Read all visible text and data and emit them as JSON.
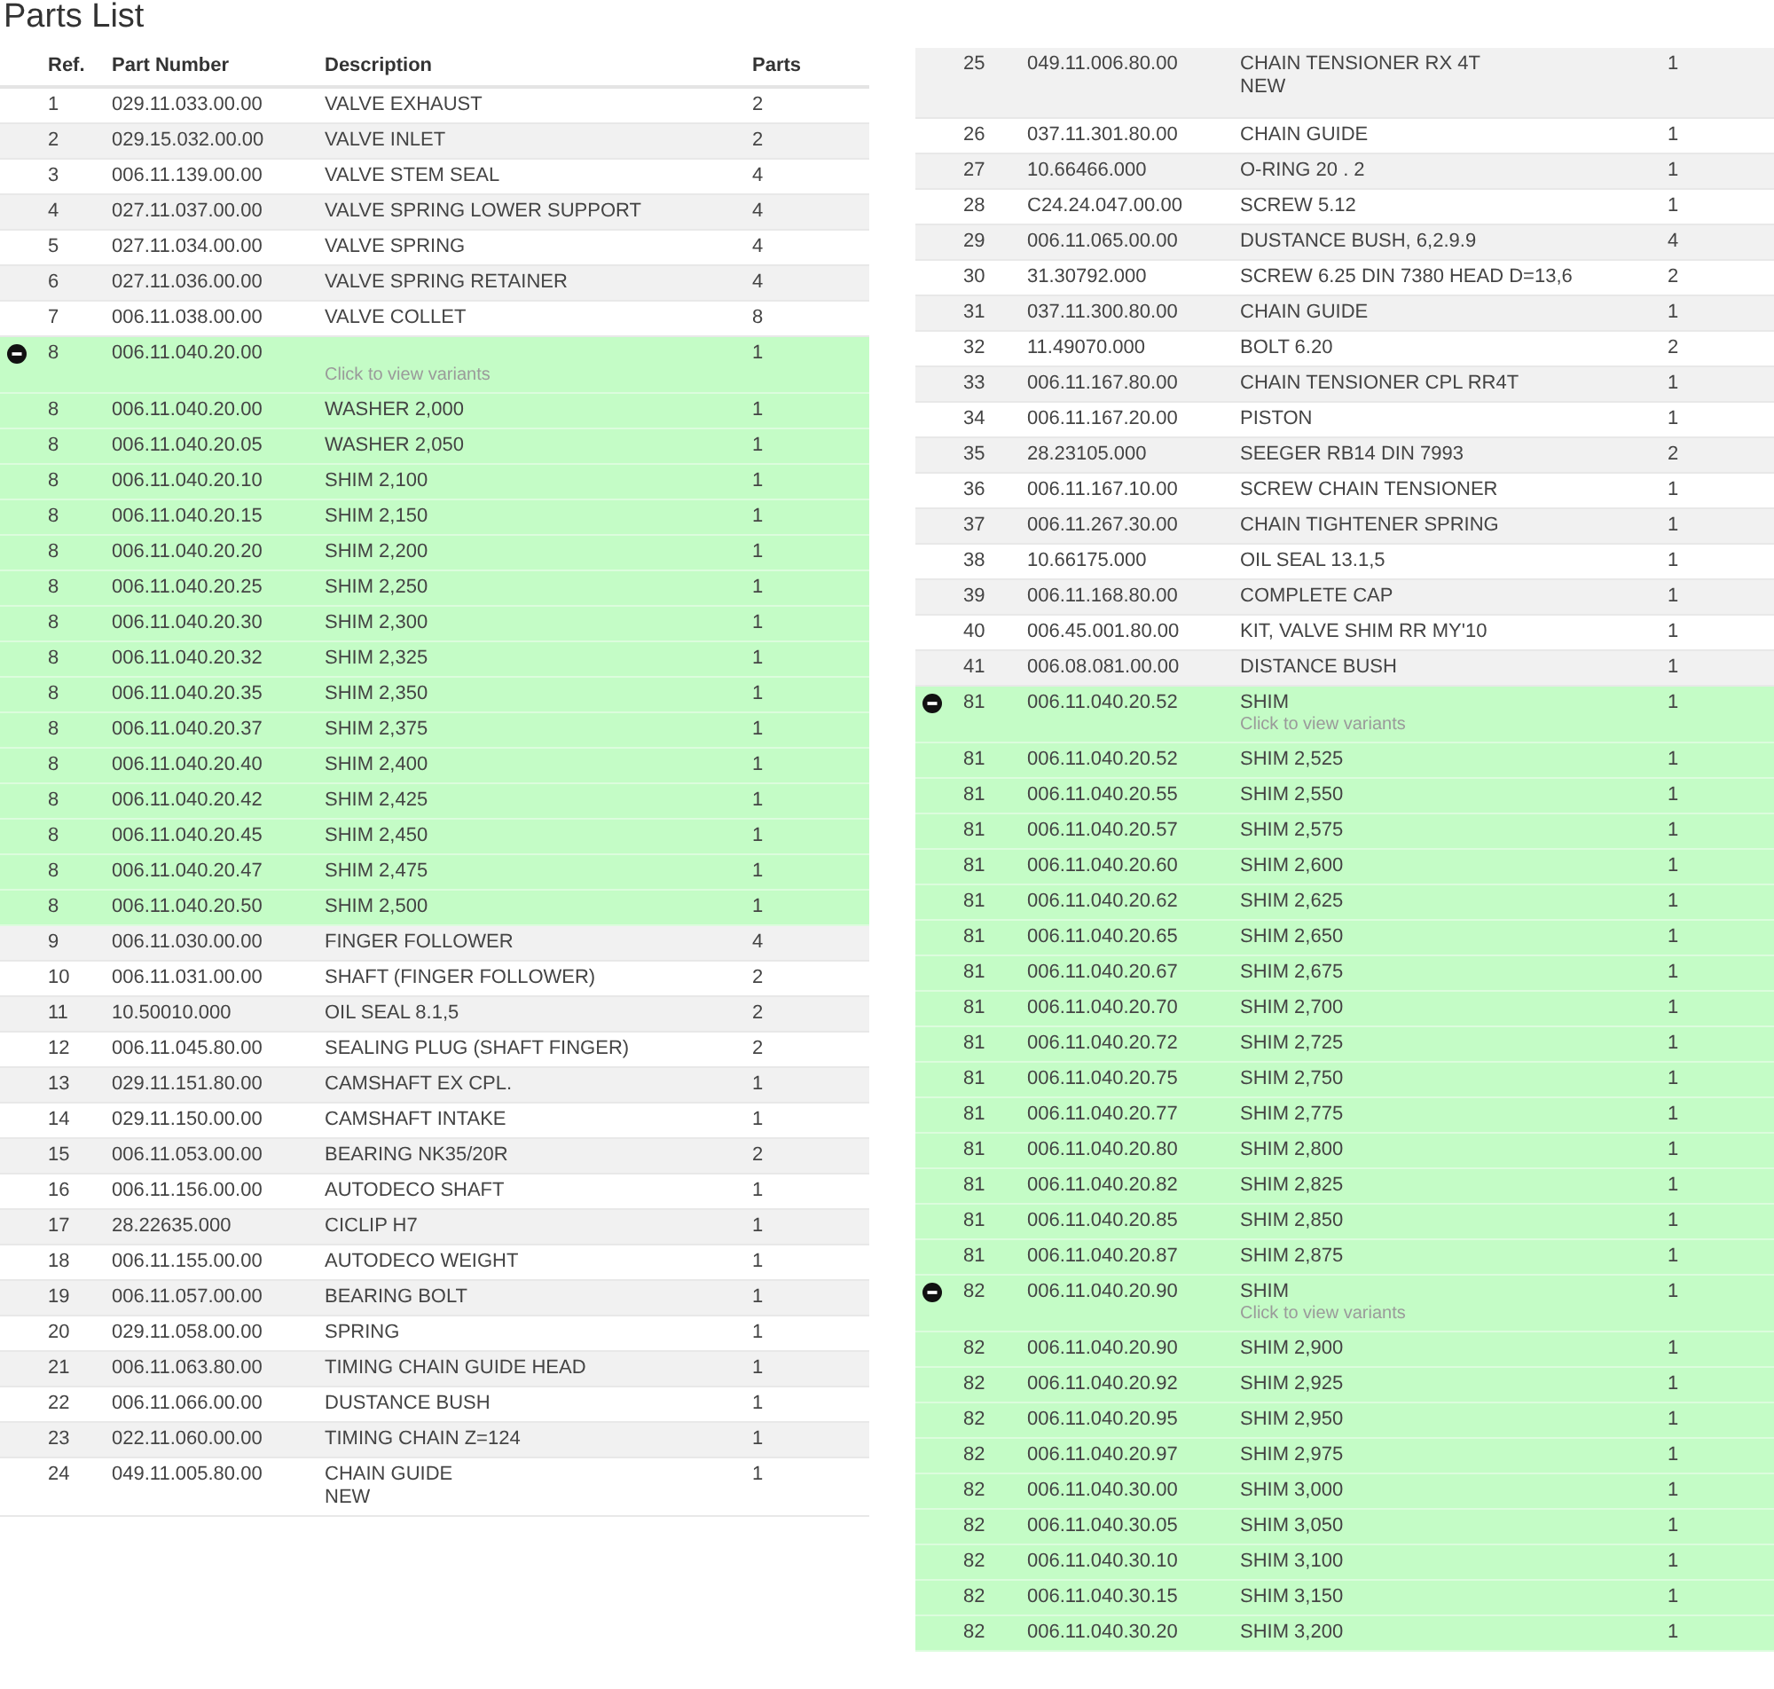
{
  "title": "Parts List",
  "columns": [
    "Ref.",
    "Part Number",
    "Description",
    "Parts"
  ],
  "left_rows": [
    {
      "kind": "part",
      "ref": "1",
      "part_number": "029.11.033.00.00",
      "description": "VALVE EXHAUST",
      "parts": "2"
    },
    {
      "kind": "part",
      "ref": "2",
      "part_number": "029.15.032.00.00",
      "description": "VALVE INLET",
      "parts": "2"
    },
    {
      "kind": "part",
      "ref": "3",
      "part_number": "006.11.139.00.00",
      "description": "VALVE STEM SEAL",
      "parts": "4"
    },
    {
      "kind": "part",
      "ref": "4",
      "part_number": "027.11.037.00.00",
      "description": "VALVE SPRING LOWER SUPPORT",
      "parts": "4"
    },
    {
      "kind": "part",
      "ref": "5",
      "part_number": "027.11.034.00.00",
      "description": "VALVE SPRING",
      "parts": "4"
    },
    {
      "kind": "part",
      "ref": "6",
      "part_number": "027.11.036.00.00",
      "description": "VALVE SPRING RETAINER",
      "parts": "4"
    },
    {
      "kind": "part",
      "ref": "7",
      "part_number": "006.11.038.00.00",
      "description": "VALVE COLLET",
      "parts": "8"
    },
    {
      "kind": "group",
      "expanded": true,
      "ref": "8",
      "part_number": "006.11.040.20.00",
      "hint": "Click to view variants",
      "parts": "1"
    },
    {
      "kind": "variant",
      "ref": "8",
      "part_number": "006.11.040.20.00",
      "description": "WASHER 2,000",
      "parts": "1"
    },
    {
      "kind": "variant",
      "ref": "8",
      "part_number": "006.11.040.20.05",
      "description": "WASHER 2,050",
      "parts": "1"
    },
    {
      "kind": "variant",
      "ref": "8",
      "part_number": "006.11.040.20.10",
      "description": "SHIM 2,100",
      "parts": "1"
    },
    {
      "kind": "variant",
      "ref": "8",
      "part_number": "006.11.040.20.15",
      "description": "SHIM 2,150",
      "parts": "1"
    },
    {
      "kind": "variant",
      "ref": "8",
      "part_number": "006.11.040.20.20",
      "description": "SHIM 2,200",
      "parts": "1"
    },
    {
      "kind": "variant",
      "ref": "8",
      "part_number": "006.11.040.20.25",
      "description": "SHIM 2,250",
      "parts": "1"
    },
    {
      "kind": "variant",
      "ref": "8",
      "part_number": "006.11.040.20.30",
      "description": "SHIM 2,300",
      "parts": "1"
    },
    {
      "kind": "variant",
      "ref": "8",
      "part_number": "006.11.040.20.32",
      "description": "SHIM 2,325",
      "parts": "1"
    },
    {
      "kind": "variant",
      "ref": "8",
      "part_number": "006.11.040.20.35",
      "description": "SHIM 2,350",
      "parts": "1"
    },
    {
      "kind": "variant",
      "ref": "8",
      "part_number": "006.11.040.20.37",
      "description": "SHIM 2,375",
      "parts": "1"
    },
    {
      "kind": "variant",
      "ref": "8",
      "part_number": "006.11.040.20.40",
      "description": "SHIM 2,400",
      "parts": "1"
    },
    {
      "kind": "variant",
      "ref": "8",
      "part_number": "006.11.040.20.42",
      "description": "SHIM 2,425",
      "parts": "1"
    },
    {
      "kind": "variant",
      "ref": "8",
      "part_number": "006.11.040.20.45",
      "description": "SHIM 2,450",
      "parts": "1"
    },
    {
      "kind": "variant",
      "ref": "8",
      "part_number": "006.11.040.20.47",
      "description": "SHIM 2,475",
      "parts": "1"
    },
    {
      "kind": "variant",
      "ref": "8",
      "part_number": "006.11.040.20.50",
      "description": "SHIM 2,500",
      "parts": "1"
    },
    {
      "kind": "part",
      "ref": "9",
      "part_number": "006.11.030.00.00",
      "description": "FINGER FOLLOWER",
      "parts": "4"
    },
    {
      "kind": "part",
      "ref": "10",
      "part_number": "006.11.031.00.00",
      "description": "SHAFT (FINGER FOLLOWER)",
      "parts": "2"
    },
    {
      "kind": "part",
      "ref": "11",
      "part_number": "10.50010.000",
      "description": "OIL SEAL 8.1,5",
      "parts": "2"
    },
    {
      "kind": "part",
      "ref": "12",
      "part_number": "006.11.045.80.00",
      "description": "SEALING PLUG (SHAFT FINGER)",
      "parts": "2"
    },
    {
      "kind": "part",
      "ref": "13",
      "part_number": "029.11.151.80.00",
      "description": "CAMSHAFT EX CPL.",
      "parts": "1"
    },
    {
      "kind": "part",
      "ref": "14",
      "part_number": "029.11.150.00.00",
      "description": "CAMSHAFT INTAKE",
      "parts": "1"
    },
    {
      "kind": "part",
      "ref": "15",
      "part_number": "006.11.053.00.00",
      "description": "BEARING NK35/20R",
      "parts": "2"
    },
    {
      "kind": "part",
      "ref": "16",
      "part_number": "006.11.156.00.00",
      "description": "AUTODECO SHAFT",
      "parts": "1"
    },
    {
      "kind": "part",
      "ref": "17",
      "part_number": "28.22635.000",
      "description": "CICLIP H7",
      "parts": "1"
    },
    {
      "kind": "part",
      "ref": "18",
      "part_number": "006.11.155.00.00",
      "description": "AUTODECO WEIGHT",
      "parts": "1"
    },
    {
      "kind": "part",
      "ref": "19",
      "part_number": "006.11.057.00.00",
      "description": "BEARING BOLT",
      "parts": "1"
    },
    {
      "kind": "part",
      "ref": "20",
      "part_number": "029.11.058.00.00",
      "description": "SPRING",
      "parts": "1"
    },
    {
      "kind": "part",
      "ref": "21",
      "part_number": "006.11.063.80.00",
      "description": "TIMING CHAIN GUIDE HEAD",
      "parts": "1"
    },
    {
      "kind": "part",
      "ref": "22",
      "part_number": "006.11.066.00.00",
      "description": "DUSTANCE BUSH",
      "parts": "1"
    },
    {
      "kind": "part",
      "ref": "23",
      "part_number": "022.11.060.00.00",
      "description": "TIMING CHAIN Z=124",
      "parts": "1"
    },
    {
      "kind": "part",
      "ref": "24",
      "part_number": "049.11.005.80.00",
      "description": "CHAIN GUIDE\nNEW",
      "parts": "1"
    }
  ],
  "right_rows": [
    {
      "kind": "part",
      "ref": "25",
      "part_number": "049.11.006.80.00",
      "description": "CHAIN TENSIONER RX 4T\nNEW",
      "parts": "1"
    },
    {
      "kind": "part",
      "ref": "26",
      "part_number": "037.11.301.80.00",
      "description": "CHAIN GUIDE",
      "parts": "1"
    },
    {
      "kind": "part",
      "ref": "27",
      "part_number": "10.66466.000",
      "description": "O-RING 20 . 2",
      "parts": "1"
    },
    {
      "kind": "part",
      "ref": "28",
      "part_number": "C24.24.047.00.00",
      "description": "SCREW 5.12",
      "parts": "1"
    },
    {
      "kind": "part",
      "ref": "29",
      "part_number": "006.11.065.00.00",
      "description": "DUSTANCE BUSH, 6,2.9.9",
      "parts": "4"
    },
    {
      "kind": "part",
      "ref": "30",
      "part_number": "31.30792.000",
      "description": "SCREW 6.25 DIN 7380 HEAD D=13,6",
      "parts": "2"
    },
    {
      "kind": "part",
      "ref": "31",
      "part_number": "037.11.300.80.00",
      "description": "CHAIN GUIDE",
      "parts": "1"
    },
    {
      "kind": "part",
      "ref": "32",
      "part_number": "11.49070.000",
      "description": "BOLT 6.20",
      "parts": "2"
    },
    {
      "kind": "part",
      "ref": "33",
      "part_number": "006.11.167.80.00",
      "description": "CHAIN TENSIONER CPL RR4T",
      "parts": "1"
    },
    {
      "kind": "part",
      "ref": "34",
      "part_number": "006.11.167.20.00",
      "description": "PISTON",
      "parts": "1"
    },
    {
      "kind": "part",
      "ref": "35",
      "part_number": "28.23105.000",
      "description": "SEEGER RB14 DIN 7993",
      "parts": "2"
    },
    {
      "kind": "part",
      "ref": "36",
      "part_number": "006.11.167.10.00",
      "description": "SCREW CHAIN TENSIONER",
      "parts": "1"
    },
    {
      "kind": "part",
      "ref": "37",
      "part_number": "006.11.267.30.00",
      "description": "CHAIN TIGHTENER SPRING",
      "parts": "1"
    },
    {
      "kind": "part",
      "ref": "38",
      "part_number": "10.66175.000",
      "description": "OIL SEAL 13.1,5",
      "parts": "1"
    },
    {
      "kind": "part",
      "ref": "39",
      "part_number": "006.11.168.80.00",
      "description": "COMPLETE CAP",
      "parts": "1"
    },
    {
      "kind": "part",
      "ref": "40",
      "part_number": "006.45.001.80.00",
      "description": "KIT, VALVE SHIM RR MY'10",
      "parts": "1"
    },
    {
      "kind": "part",
      "ref": "41",
      "part_number": "006.08.081.00.00",
      "description": "DISTANCE BUSH",
      "parts": "1"
    },
    {
      "kind": "group",
      "expanded": true,
      "ref": "81",
      "part_number": "006.11.040.20.52",
      "description": "SHIM",
      "hint": "Click to view variants",
      "parts": "1"
    },
    {
      "kind": "variant",
      "ref": "81",
      "part_number": "006.11.040.20.52",
      "description": "SHIM 2,525",
      "parts": "1"
    },
    {
      "kind": "variant",
      "ref": "81",
      "part_number": "006.11.040.20.55",
      "description": "SHIM 2,550",
      "parts": "1"
    },
    {
      "kind": "variant",
      "ref": "81",
      "part_number": "006.11.040.20.57",
      "description": "SHIM 2,575",
      "parts": "1"
    },
    {
      "kind": "variant",
      "ref": "81",
      "part_number": "006.11.040.20.60",
      "description": "SHIM 2,600",
      "parts": "1"
    },
    {
      "kind": "variant",
      "ref": "81",
      "part_number": "006.11.040.20.62",
      "description": "SHIM 2,625",
      "parts": "1"
    },
    {
      "kind": "variant",
      "ref": "81",
      "part_number": "006.11.040.20.65",
      "description": "SHIM 2,650",
      "parts": "1"
    },
    {
      "kind": "variant",
      "ref": "81",
      "part_number": "006.11.040.20.67",
      "description": "SHIM 2,675",
      "parts": "1"
    },
    {
      "kind": "variant",
      "ref": "81",
      "part_number": "006.11.040.20.70",
      "description": "SHIM 2,700",
      "parts": "1"
    },
    {
      "kind": "variant",
      "ref": "81",
      "part_number": "006.11.040.20.72",
      "description": "SHIM 2,725",
      "parts": "1"
    },
    {
      "kind": "variant",
      "ref": "81",
      "part_number": "006.11.040.20.75",
      "description": "SHIM 2,750",
      "parts": "1"
    },
    {
      "kind": "variant",
      "ref": "81",
      "part_number": "006.11.040.20.77",
      "description": "SHIM 2,775",
      "parts": "1"
    },
    {
      "kind": "variant",
      "ref": "81",
      "part_number": "006.11.040.20.80",
      "description": "SHIM 2,800",
      "parts": "1"
    },
    {
      "kind": "variant",
      "ref": "81",
      "part_number": "006.11.040.20.82",
      "description": "SHIM 2,825",
      "parts": "1"
    },
    {
      "kind": "variant",
      "ref": "81",
      "part_number": "006.11.040.20.85",
      "description": "SHIM 2,850",
      "parts": "1"
    },
    {
      "kind": "variant",
      "ref": "81",
      "part_number": "006.11.040.20.87",
      "description": "SHIM 2,875",
      "parts": "1"
    },
    {
      "kind": "group",
      "expanded": true,
      "ref": "82",
      "part_number": "006.11.040.20.90",
      "description": "SHIM",
      "hint": "Click to view variants",
      "parts": "1"
    },
    {
      "kind": "variant",
      "ref": "82",
      "part_number": "006.11.040.20.90",
      "description": "SHIM 2,900",
      "parts": "1"
    },
    {
      "kind": "variant",
      "ref": "82",
      "part_number": "006.11.040.20.92",
      "description": "SHIM 2,925",
      "parts": "1"
    },
    {
      "kind": "variant",
      "ref": "82",
      "part_number": "006.11.040.20.95",
      "description": "SHIM 2,950",
      "parts": "1"
    },
    {
      "kind": "variant",
      "ref": "82",
      "part_number": "006.11.040.20.97",
      "description": "SHIM 2,975",
      "parts": "1"
    },
    {
      "kind": "variant",
      "ref": "82",
      "part_number": "006.11.040.30.00",
      "description": "SHIM 3,000",
      "parts": "1"
    },
    {
      "kind": "variant",
      "ref": "82",
      "part_number": "006.11.040.30.05",
      "description": "SHIM 3,050",
      "parts": "1"
    },
    {
      "kind": "variant",
      "ref": "82",
      "part_number": "006.11.040.30.10",
      "description": "SHIM 3,100",
      "parts": "1"
    },
    {
      "kind": "variant",
      "ref": "82",
      "part_number": "006.11.040.30.15",
      "description": "SHIM 3,150",
      "parts": "1"
    },
    {
      "kind": "variant",
      "ref": "82",
      "part_number": "006.11.040.30.20",
      "description": "SHIM 3,200",
      "parts": "1"
    }
  ]
}
